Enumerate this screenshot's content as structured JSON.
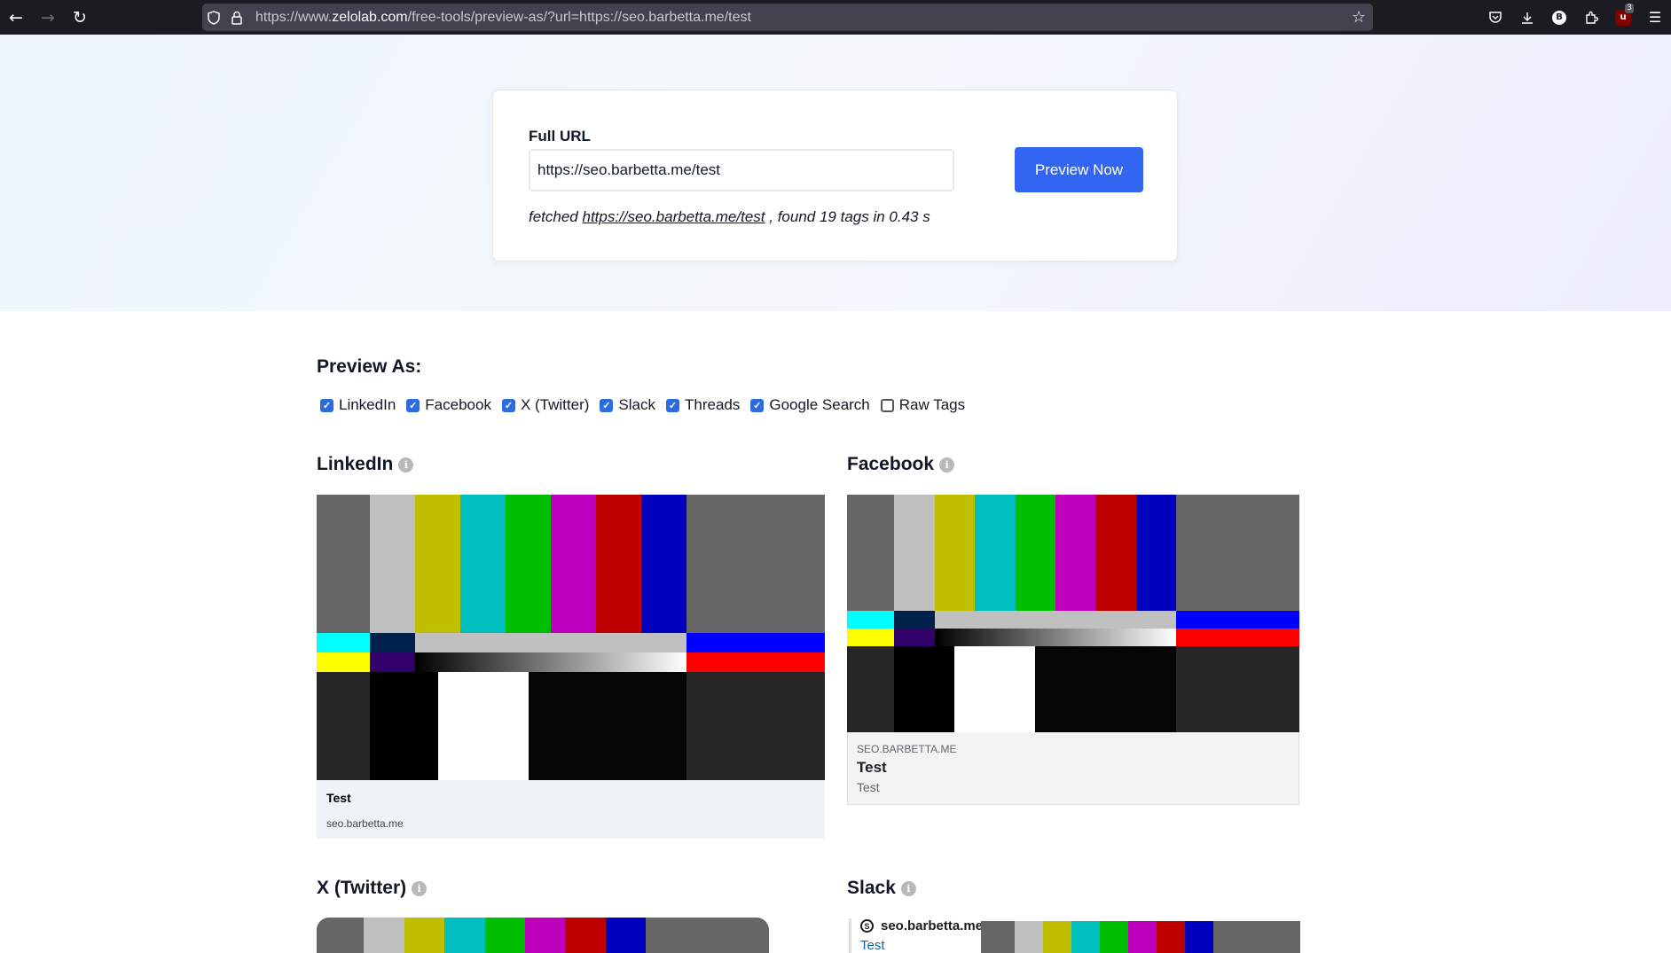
{
  "browser": {
    "url_prefix": "https://www.",
    "url_host": "zelolab.com",
    "url_path": "/free-tools/preview-as/?url=https://seo.barbetta.me/test",
    "icons": [
      "back-icon",
      "forward-icon",
      "reload-icon",
      "shield-icon",
      "lock-icon",
      "bookmark-star-icon",
      "pocket-icon",
      "download-icon",
      "profile-icon",
      "extensions-icon",
      "ublock-icon",
      "menu-icon"
    ],
    "profile_letter": "B",
    "ublock_count": "3"
  },
  "form": {
    "label": "Full URL",
    "url_value": "https://seo.barbetta.me/test",
    "button": "Preview Now",
    "fetched_prefix": "fetched",
    "fetched_link": "https://seo.barbetta.me/test",
    "fetched_suffix": ", found 19 tags in 0.43 s"
  },
  "preview_as": {
    "title": "Preview As:",
    "options": [
      {
        "label": "LinkedIn",
        "checked": true
      },
      {
        "label": "Facebook",
        "checked": true
      },
      {
        "label": "X (Twitter)",
        "checked": true
      },
      {
        "label": "Slack",
        "checked": true
      },
      {
        "label": "Threads",
        "checked": true
      },
      {
        "label": "Google Search",
        "checked": true
      },
      {
        "label": "Raw Tags",
        "checked": false
      }
    ]
  },
  "linkedin": {
    "title": "LinkedIn",
    "card_title": "Test",
    "card_domain": "seo.barbetta.me"
  },
  "facebook": {
    "title": "Facebook",
    "card_domain": "SEO.BARBETTA.ME",
    "card_title": "Test",
    "card_description": "Test"
  },
  "twitter": {
    "title": "X (Twitter)"
  },
  "slack": {
    "title": "Slack",
    "site_name": "seo.barbetta.me",
    "link_title": "Test"
  },
  "colors": {
    "accent": "#3266f2",
    "checkbox": "#2d6cdf",
    "bars": [
      "#666666",
      "#bfbfbf",
      "#bfbf00",
      "#00bfbf",
      "#00bf00",
      "#bf00bf",
      "#bf0000",
      "#0000bf",
      "#666666"
    ]
  }
}
